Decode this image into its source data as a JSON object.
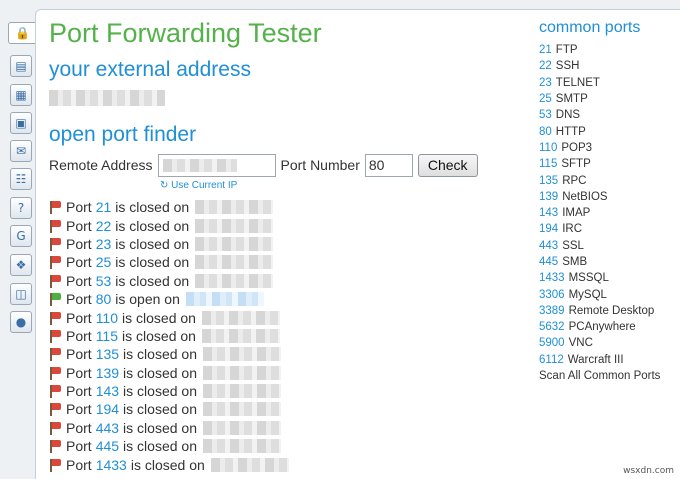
{
  "rail": {
    "icons": [
      "lock-icon",
      "map-icon",
      "map-alt-icon",
      "server-icon",
      "email-icon",
      "network-icon",
      "help-icon",
      "google-icon",
      "windows-icon",
      "devices-icon",
      "globe-icon"
    ]
  },
  "main": {
    "title": "Port Forwarding Tester",
    "external_heading": "your external address",
    "finder_heading": "open port finder",
    "remote_address_label": "Remote Address",
    "port_number_label": "Port Number",
    "port_number_value": "80",
    "check_label": "Check",
    "use_current_ip": "Use Current IP",
    "results": [
      {
        "prefix": "Port",
        "port": "21",
        "status": "is closed on",
        "state": "closed"
      },
      {
        "prefix": "Port",
        "port": "22",
        "status": "is closed on",
        "state": "closed"
      },
      {
        "prefix": "Port",
        "port": "23",
        "status": "is closed on",
        "state": "closed"
      },
      {
        "prefix": "Port",
        "port": "25",
        "status": "is closed on",
        "state": "closed"
      },
      {
        "prefix": "Port",
        "port": "53",
        "status": "is closed on",
        "state": "closed"
      },
      {
        "prefix": "Port",
        "port": "80",
        "status": "is open on",
        "state": "open"
      },
      {
        "prefix": "Port",
        "port": "110",
        "status": "is closed on",
        "state": "closed"
      },
      {
        "prefix": "Port",
        "port": "115",
        "status": "is closed on",
        "state": "closed"
      },
      {
        "prefix": "Port",
        "port": "135",
        "status": "is closed on",
        "state": "closed"
      },
      {
        "prefix": "Port",
        "port": "139",
        "status": "is closed on",
        "state": "closed"
      },
      {
        "prefix": "Port",
        "port": "143",
        "status": "is closed on",
        "state": "closed"
      },
      {
        "prefix": "Port",
        "port": "194",
        "status": "is closed on",
        "state": "closed"
      },
      {
        "prefix": "Port",
        "port": "443",
        "status": "is closed on",
        "state": "closed"
      },
      {
        "prefix": "Port",
        "port": "445",
        "status": "is closed on",
        "state": "closed"
      },
      {
        "prefix": "Port",
        "port": "1433",
        "status": "is closed on",
        "state": "closed"
      }
    ]
  },
  "sidebar": {
    "title": "common ports",
    "ports": [
      {
        "port": "21",
        "name": "FTP"
      },
      {
        "port": "22",
        "name": "SSH"
      },
      {
        "port": "23",
        "name": "TELNET"
      },
      {
        "port": "25",
        "name": "SMTP"
      },
      {
        "port": "53",
        "name": "DNS"
      },
      {
        "port": "80",
        "name": "HTTP"
      },
      {
        "port": "110",
        "name": "POP3"
      },
      {
        "port": "115",
        "name": "SFTP"
      },
      {
        "port": "135",
        "name": "RPC"
      },
      {
        "port": "139",
        "name": "NetBIOS"
      },
      {
        "port": "143",
        "name": "IMAP"
      },
      {
        "port": "194",
        "name": "IRC"
      },
      {
        "port": "443",
        "name": "SSL"
      },
      {
        "port": "445",
        "name": "SMB"
      },
      {
        "port": "1433",
        "name": "MSSQL"
      },
      {
        "port": "3306",
        "name": "MySQL"
      },
      {
        "port": "3389",
        "name": "Remote Desktop"
      },
      {
        "port": "5632",
        "name": "PCAnywhere"
      },
      {
        "port": "5900",
        "name": "VNC"
      },
      {
        "port": "6112",
        "name": "Warcraft III"
      }
    ],
    "scan_all": "Scan All Common Ports"
  },
  "watermark": "wsxdn.com",
  "colors": {
    "title_green": "#55b24a",
    "link_blue": "#1f8fd6",
    "closed_flag": "#d9483b",
    "open_flag": "#4caf3e"
  }
}
